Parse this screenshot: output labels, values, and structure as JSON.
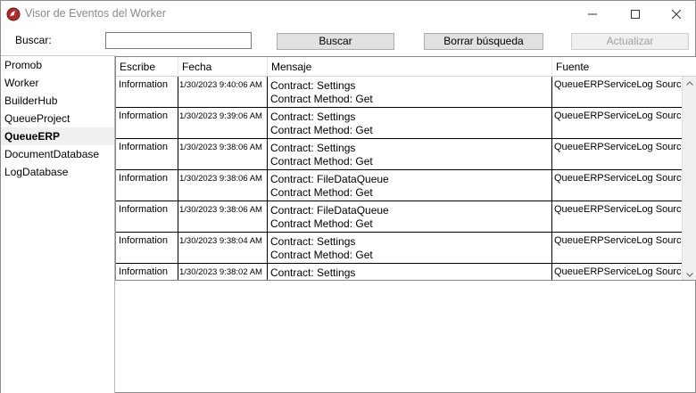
{
  "window": {
    "title": "Visor de Eventos del Worker",
    "icon": "app-logo-icon"
  },
  "toolbar": {
    "search_label": "Buscar:",
    "search_value": "",
    "search_button": "Buscar",
    "clear_button": "Borrar búsqueda",
    "refresh_button": "Actualizar"
  },
  "sidebar": {
    "items": [
      {
        "label": "Promob",
        "selected": false
      },
      {
        "label": "Worker",
        "selected": false
      },
      {
        "label": "BuilderHub",
        "selected": false
      },
      {
        "label": "QueueProject",
        "selected": false
      },
      {
        "label": "QueueERP",
        "selected": true
      },
      {
        "label": "DocumentDatabase",
        "selected": false
      },
      {
        "label": "LogDatabase",
        "selected": false
      }
    ]
  },
  "grid": {
    "columns": [
      "Escribe",
      "Fecha",
      "Mensaje",
      "Fuente"
    ],
    "rows": [
      {
        "escribe": "Information",
        "fecha": "1/30/2023 9:40:06 AM",
        "msg1": "Contract: Settings",
        "msg2": "Contract Method: Get",
        "fuente": "QueueERPServiceLog Source"
      },
      {
        "escribe": "Information",
        "fecha": "1/30/2023 9:39:06 AM",
        "msg1": "Contract: Settings",
        "msg2": "Contract Method: Get",
        "fuente": "QueueERPServiceLog Source"
      },
      {
        "escribe": "Information",
        "fecha": "1/30/2023 9:38:06 AM",
        "msg1": "Contract: Settings",
        "msg2": "Contract Method: Get",
        "fuente": "QueueERPServiceLog Source"
      },
      {
        "escribe": "Information",
        "fecha": "1/30/2023 9:38:06 AM",
        "msg1": "Contract: FileDataQueue",
        "msg2": "Contract Method: Get",
        "fuente": "QueueERPServiceLog Source"
      },
      {
        "escribe": "Information",
        "fecha": "1/30/2023 9:38:06 AM",
        "msg1": "Contract: FileDataQueue",
        "msg2": "Contract Method: Get",
        "fuente": "QueueERPServiceLog Source"
      },
      {
        "escribe": "Information",
        "fecha": "1/30/2023 9:38:04 AM",
        "msg1": "Contract: Settings",
        "msg2": "Contract Method: Get",
        "fuente": "QueueERPServiceLog Source"
      },
      {
        "escribe": "Information",
        "fecha": "1/30/2023 9:38:02 AM",
        "msg1": "Contract: Settings",
        "msg2": "",
        "fuente": "QueueERPServiceLog Source"
      }
    ]
  }
}
